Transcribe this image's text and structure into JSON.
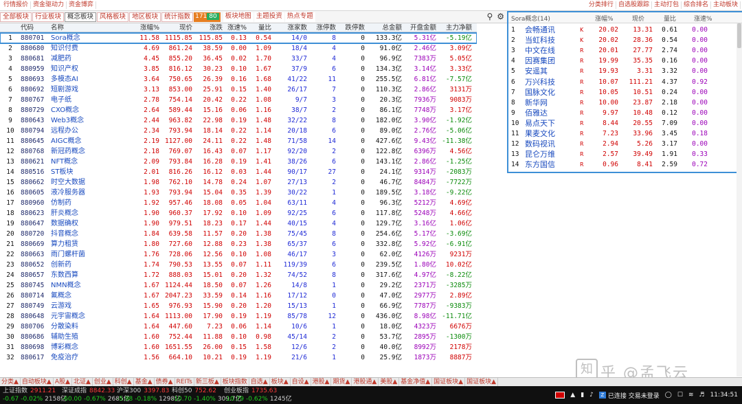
{
  "top_left_links": [
    "行情报价",
    "资金驱动力",
    "资金博弈"
  ],
  "top_right_links": [
    "分类排行",
    "自选股跟踪",
    "主动打包",
    "综合排名",
    "主动板块"
  ],
  "category_tabs": [
    "全部板块",
    "行业板块",
    "概念板块",
    "风格板块",
    "地区板块",
    "统计指数"
  ],
  "active_category": "概念板块",
  "ratio": {
    "up": "171",
    "down": "80"
  },
  "extra_tabs": [
    "板块地图",
    "主题投资",
    "热点专题"
  ],
  "tools": {
    "search_icon": "search-icon",
    "gear_icon": "gear-icon"
  },
  "table": {
    "headers": [
      "",
      "代码",
      "名称",
      "涨幅%",
      "现价",
      "涨跌",
      "涨速%",
      "量比",
      "涨家数",
      "涨停数",
      "跌停数",
      "总金额",
      "开盘金额",
      "主力净额"
    ],
    "rows": [
      [
        "1",
        "880701",
        "Sora概念",
        "11.58",
        "1115.85",
        "115.85",
        "0.13",
        "0.54",
        "14/0",
        "8",
        "0",
        "133.3亿",
        "5.31亿",
        "-5.19亿"
      ],
      [
        "2",
        "880680",
        "知识付费",
        "4.69",
        "861.24",
        "38.59",
        "0.00",
        "1.09",
        "18/4",
        "4",
        "0",
        "91.0亿",
        "2.46亿",
        "3.09亿"
      ],
      [
        "3",
        "880681",
        "减肥药",
        "4.45",
        "855.20",
        "36.45",
        "0.02",
        "1.70",
        "33/7",
        "4",
        "0",
        "96.9亿",
        "7383万",
        "5.05亿"
      ],
      [
        "4",
        "880959",
        "知识产权",
        "3.85",
        "816.12",
        "30.23",
        "0.10",
        "1.67",
        "37/9",
        "6",
        "0",
        "134.3亿",
        "3.14亿",
        "3.33亿"
      ],
      [
        "5",
        "880693",
        "多模态AI",
        "3.64",
        "750.65",
        "26.39",
        "0.16",
        "1.68",
        "41/22",
        "11",
        "0",
        "255.5亿",
        "6.81亿",
        "-7.57亿"
      ],
      [
        "6",
        "880692",
        "短剧游戏",
        "3.13",
        "853.00",
        "25.91",
        "0.15",
        "1.40",
        "26/17",
        "7",
        "0",
        "110.3亿",
        "2.86亿",
        "3131万"
      ],
      [
        "7",
        "880767",
        "电子纸",
        "2.78",
        "754.14",
        "20.42",
        "0.22",
        "1.08",
        "9/7",
        "3",
        "0",
        "20.3亿",
        "7936万",
        "9083万"
      ],
      [
        "8",
        "880729",
        "CXO概念",
        "2.64",
        "589.44",
        "15.16",
        "0.06",
        "1.16",
        "38/7",
        "2",
        "0",
        "86.1亿",
        "7748万",
        "3.17亿"
      ],
      [
        "9",
        "880643",
        "Web3概念",
        "2.44",
        "963.82",
        "22.98",
        "0.19",
        "1.48",
        "32/22",
        "8",
        "0",
        "182.0亿",
        "3.90亿",
        "-1.92亿"
      ],
      [
        "10",
        "880794",
        "远程办公",
        "2.34",
        "793.94",
        "18.14",
        "0.22",
        "1.14",
        "20/18",
        "6",
        "0",
        "89.0亿",
        "2.76亿",
        "-5.06亿"
      ],
      [
        "11",
        "880645",
        "AIGC概念",
        "2.19",
        "1127.00",
        "24.11",
        "0.22",
        "1.48",
        "71/58",
        "14",
        "0",
        "427.6亿",
        "9.43亿",
        "-11.38亿"
      ],
      [
        "12",
        "880768",
        "新冠药概念",
        "2.18",
        "769.07",
        "16.43",
        "0.07",
        "1.17",
        "92/20",
        "2",
        "0",
        "122.8亿",
        "6396万",
        "4.56亿"
      ],
      [
        "13",
        "880621",
        "NFT概念",
        "2.09",
        "793.84",
        "16.28",
        "0.19",
        "1.41",
        "38/26",
        "6",
        "0",
        "143.1亿",
        "2.86亿",
        "-1.25亿"
      ],
      [
        "14",
        "880516",
        "ST板块",
        "2.01",
        "816.26",
        "16.12",
        "0.03",
        "1.44",
        "90/17",
        "27",
        "0",
        "24.1亿",
        "9314万",
        "-2083万"
      ],
      [
        "15",
        "880662",
        "时空大数据",
        "1.98",
        "762.10",
        "14.78",
        "0.24",
        "1.07",
        "27/13",
        "2",
        "0",
        "46.7亿",
        "8484万",
        "-7722万"
      ],
      [
        "16",
        "880605",
        "液冷服务器",
        "1.93",
        "793.94",
        "15.04",
        "0.35",
        "1.39",
        "30/22",
        "1",
        "0",
        "189.5亿",
        "3.18亿",
        "-9.22亿"
      ],
      [
        "17",
        "880960",
        "仿制药",
        "1.92",
        "957.46",
        "18.08",
        "0.05",
        "1.04",
        "63/11",
        "4",
        "0",
        "96.3亿",
        "5212万",
        "4.69亿"
      ],
      [
        "18",
        "880623",
        "肝炎概念",
        "1.90",
        "960.37",
        "17.92",
        "0.10",
        "1.09",
        "92/25",
        "6",
        "0",
        "117.8亿",
        "5248万",
        "4.66亿"
      ],
      [
        "19",
        "880647",
        "数据确权",
        "1.90",
        "979.51",
        "18.23",
        "0.17",
        "1.44",
        "40/15",
        "4",
        "0",
        "129.7亿",
        "3.16亿",
        "1.06亿"
      ],
      [
        "20",
        "880720",
        "抖音概念",
        "1.84",
        "639.58",
        "11.57",
        "0.20",
        "1.38",
        "75/45",
        "8",
        "0",
        "254.6亿",
        "5.17亿",
        "-3.69亿"
      ],
      [
        "21",
        "880669",
        "算力租赁",
        "1.80",
        "727.60",
        "12.88",
        "0.23",
        "1.38",
        "65/37",
        "6",
        "0",
        "332.8亿",
        "5.92亿",
        "-6.91亿"
      ],
      [
        "22",
        "880663",
        "雨门螺杆菌",
        "1.76",
        "728.06",
        "12.56",
        "0.10",
        "1.08",
        "46/17",
        "3",
        "0",
        "62.0亿",
        "4126万",
        "9231万"
      ],
      [
        "23",
        "880652",
        "创新药",
        "1.74",
        "790.53",
        "13.55",
        "0.07",
        "1.11",
        "119/39",
        "6",
        "0",
        "239.5亿",
        "1.80亿",
        "10.02亿"
      ],
      [
        "24",
        "880657",
        "东数西算",
        "1.72",
        "888.03",
        "15.01",
        "0.20",
        "1.32",
        "74/52",
        "8",
        "0",
        "317.6亿",
        "4.97亿",
        "-8.22亿"
      ],
      [
        "25",
        "880745",
        "NMN概念",
        "1.67",
        "1124.44",
        "18.50",
        "0.07",
        "1.26",
        "14/8",
        "1",
        "0",
        "29.2亿",
        "2371万",
        "-3285万"
      ],
      [
        "26",
        "880714",
        "氟概念",
        "1.67",
        "2047.23",
        "33.59",
        "0.14",
        "1.16",
        "17/12",
        "0",
        "0",
        "47.0亿",
        "2977万",
        "2.89亿"
      ],
      [
        "27",
        "880749",
        "云游戏",
        "1.65",
        "976.93",
        "15.90",
        "0.20",
        "1.20",
        "15/13",
        "1",
        "0",
        "66.9亿",
        "7787万",
        "-9383万"
      ],
      [
        "28",
        "880648",
        "元宇宙概念",
        "1.64",
        "1113.00",
        "17.90",
        "0.19",
        "1.19",
        "85/78",
        "12",
        "0",
        "436.0亿",
        "8.98亿",
        "-11.71亿"
      ],
      [
        "29",
        "880706",
        "分散染料",
        "1.64",
        "447.60",
        "7.23",
        "0.06",
        "1.14",
        "10/6",
        "1",
        "0",
        "18.0亿",
        "4323万",
        "6676万"
      ],
      [
        "30",
        "880686",
        "辅助生殖",
        "1.60",
        "752.44",
        "11.88",
        "0.10",
        "0.98",
        "45/14",
        "2",
        "0",
        "53.7亿",
        "2895万",
        "-1300万"
      ],
      [
        "31",
        "880698",
        "博彩概念",
        "1.60",
        "1651.55",
        "26.00",
        "0.15",
        "1.58",
        "12/6",
        "2",
        "0",
        "40.0亿",
        "8992万",
        "2178万"
      ],
      [
        "32",
        "880617",
        "免疫治疗",
        "1.56",
        "664.10",
        "10.21",
        "0.19",
        "1.19",
        "21/6",
        "1",
        "0",
        "25.9亿",
        "1873万",
        "8887万"
      ]
    ]
  },
  "right_panel": {
    "title": "Sora概念(14)",
    "headers": [
      "涨幅%",
      "现价",
      "量比",
      "涨速%"
    ],
    "rows": [
      [
        "1",
        "会畅通讯",
        "20.02",
        "13.31",
        "0.61",
        "0.00",
        "K"
      ],
      [
        "2",
        "当虹科技",
        "20.02",
        "28.36",
        "0.54",
        "0.00",
        "K"
      ],
      [
        "3",
        "中文在线",
        "20.01",
        "27.77",
        "2.74",
        "0.00",
        "R"
      ],
      [
        "4",
        "因赛集团",
        "19.99",
        "35.35",
        "0.16",
        "0.00",
        "R"
      ],
      [
        "5",
        "安遥其",
        "19.93",
        "3.31",
        "3.32",
        "0.00",
        "R"
      ],
      [
        "6",
        "万兴科技",
        "10.07",
        "111.21",
        "4.37",
        "0.92",
        "R"
      ],
      [
        "7",
        "国脉文化",
        "10.05",
        "10.51",
        "0.24",
        "0.00",
        "R"
      ],
      [
        "8",
        "新华网",
        "10.00",
        "23.87",
        "2.18",
        "0.00",
        "R"
      ],
      [
        "9",
        "佰雅达",
        "9.97",
        "10.48",
        "0.12",
        "0.00",
        "R"
      ],
      [
        "10",
        "易点天下",
        "8.44",
        "20.55",
        "7.09",
        "0.00",
        "R"
      ],
      [
        "11",
        "果麦文化",
        "7.23",
        "33.96",
        "3.45",
        "0.18",
        "R"
      ],
      [
        "12",
        "数码视讯",
        "2.94",
        "5.26",
        "3.17",
        "0.00",
        "R"
      ],
      [
        "13",
        "昆仑万维",
        "2.57",
        "39.49",
        "1.91",
        "0.33",
        "R"
      ],
      [
        "14",
        "东方国信",
        "0.96",
        "8.41",
        "2.59",
        "0.72",
        "R"
      ]
    ]
  },
  "bottom_tabs": [
    "分类▲",
    "自动板块▲",
    "A股▲",
    "北证▲",
    "创业▲",
    "科创▲",
    "基金▲",
    "债券▲",
    "REITs",
    "新三板▲",
    "板块指数",
    "自选▲",
    "板块▲",
    "自设▲",
    "港股▲",
    "期货▲",
    "港股通▲",
    "美股▲",
    "基金净值▲",
    "国证板块▲",
    "国证板块▲"
  ],
  "watermark": {
    "icon_char": "知",
    "text": "乎 @孟飞云"
  },
  "status": {
    "indices": [
      {
        "name": "上证指数",
        "value": "2911.21",
        "chg": "-0.67",
        "pct": "-0.02%",
        "amount": "2158亿"
      },
      {
        "name": "深证成指",
        "value": "8842.33",
        "chg": "-60.00",
        "pct": "-0.67%",
        "amount": "2685亿"
      },
      {
        "name": "沪深300",
        "value": "3397.83",
        "chg": "-5.98",
        "pct": "-0.18%",
        "amount": "1298亿"
      },
      {
        "name": "科创50",
        "value": "752.62",
        "chg": "-10.70",
        "pct": "-1.40%",
        "amount": "309.7亿"
      },
      {
        "name": "创业板指",
        "value": "1735.63",
        "chg": "-10.79",
        "pct": "-0.62%",
        "amount": "1245亿"
      }
    ],
    "connection": "已连接 交易未登录",
    "time": "11:34:51"
  }
}
